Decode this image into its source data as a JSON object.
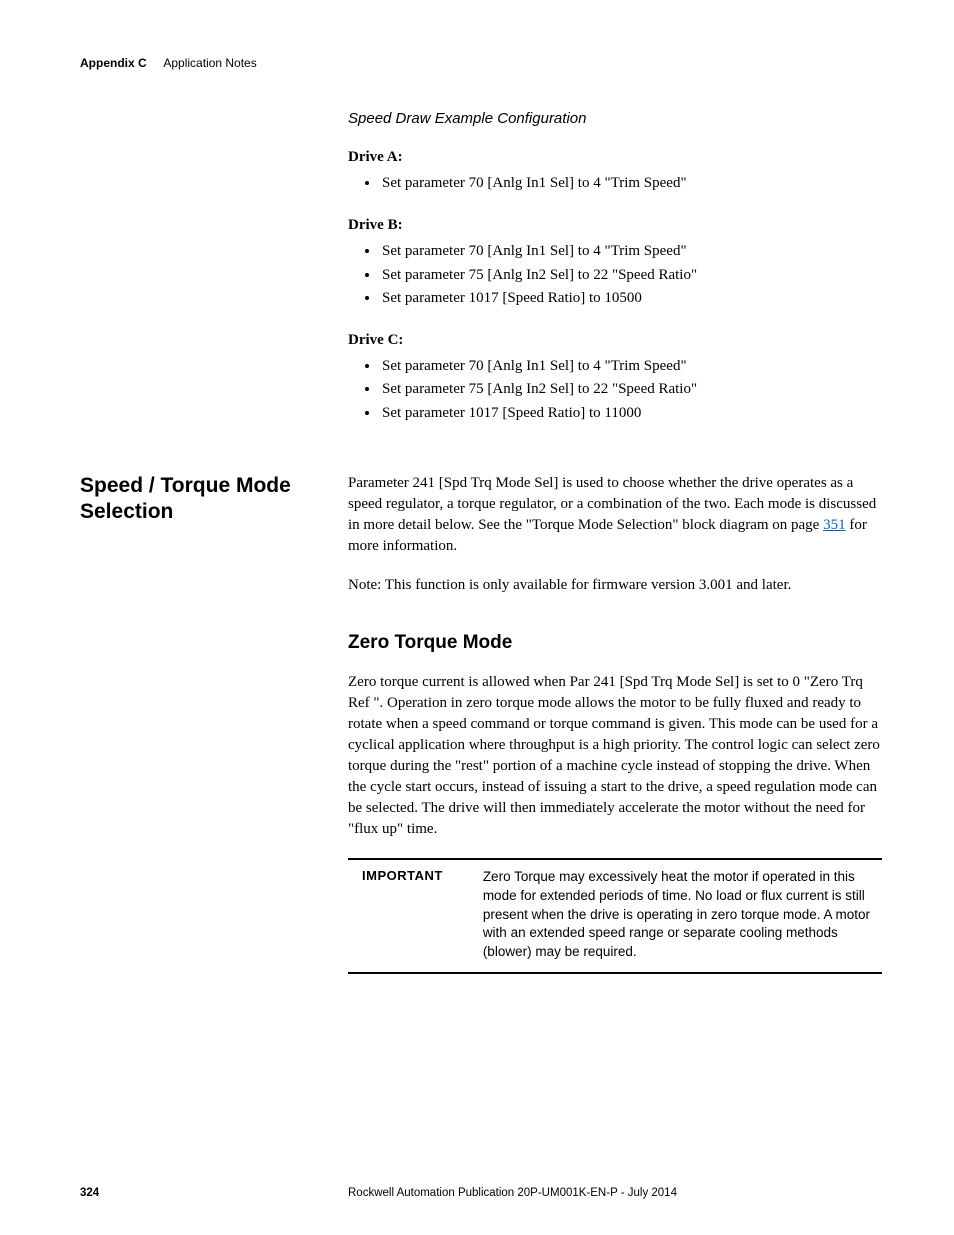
{
  "header": {
    "appendix": "Appendix C",
    "title": "Application Notes"
  },
  "example_heading": "Speed Draw Example Configuration",
  "drives": {
    "a_label": "Drive A:",
    "a_items": [
      "Set parameter 70 [Anlg In1 Sel] to 4 \"Trim Speed\""
    ],
    "b_label": "Drive B:",
    "b_items": [
      "Set parameter 70 [Anlg In1 Sel] to 4 \"Trim Speed\"",
      "Set parameter 75 [Anlg In2 Sel] to 22 \"Speed Ratio\"",
      "Set parameter 1017 [Speed Ratio] to 10500"
    ],
    "c_label": "Drive C:",
    "c_items": [
      "Set parameter 70 [Anlg In1 Sel] to 4 \"Trim Speed\"",
      "Set parameter 75 [Anlg In2 Sel] to 22 \"Speed Ratio\"",
      "Set parameter 1017 [Speed Ratio] to 11000"
    ]
  },
  "section": {
    "title": "Speed / Torque Mode Selection",
    "para_prefix": "Parameter 241 [Spd Trq Mode Sel] is used to choose whether the drive operates as a speed regulator, a torque regulator, or a combination of the two. Each mode is discussed in more detail below. See the \"Torque Mode Selection\" block diagram on page ",
    "link_text": "351",
    "para_suffix": " for more information.",
    "note": "Note: This function is only available for firmware version 3.001 and later."
  },
  "zero": {
    "heading": "Zero Torque Mode",
    "para": "Zero torque current is allowed when Par 241 [Spd Trq Mode Sel] is set to 0 \"Zero Trq Ref \". Operation in zero torque mode allows the motor to be fully fluxed and ready to rotate when a speed command or torque command is given. This mode can be used for a cyclical application where throughput is a high priority. The control logic can select zero torque during the \"rest\" portion of a machine cycle instead of stopping the drive. When the cycle start occurs, instead of issuing a start to the drive, a speed regulation mode can be selected. The drive will then immediately accelerate the motor without the need for \"flux up\" time."
  },
  "important": {
    "label": "IMPORTANT",
    "msg": "Zero Torque may excessively heat the motor if operated in this mode for extended periods of time. No load or flux current is still present when the drive is operating in zero torque mode. A motor with an extended speed range or separate cooling methods (blower) may be required."
  },
  "footer": {
    "page": "324",
    "pub": "Rockwell Automation Publication 20P-UM001K-EN-P - July 2014"
  }
}
